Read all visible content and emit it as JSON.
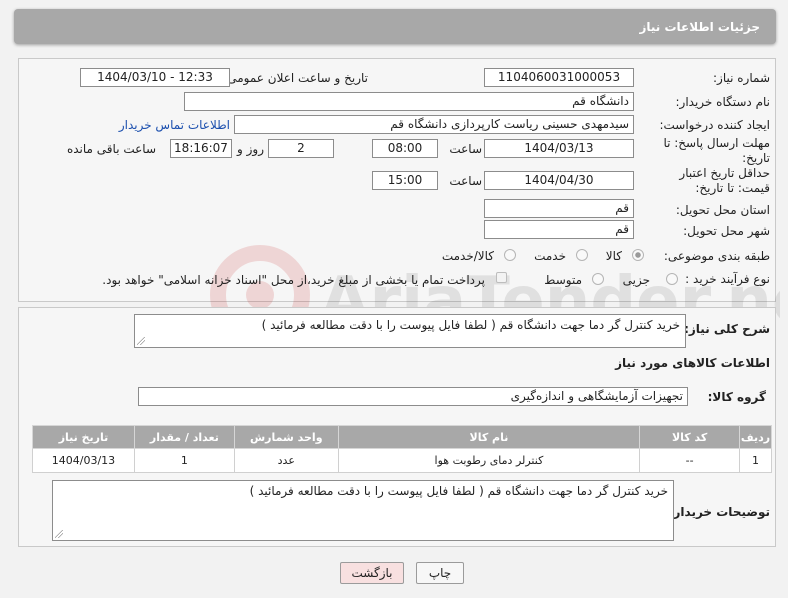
{
  "header": {
    "title": "جزئیات اطلاعات نیاز"
  },
  "form": {
    "need_number_label": "شماره نیاز:",
    "need_number": "1104060031000053",
    "announce_label": "تاریخ و ساعت اعلان عمومی:",
    "announce_value": "1404/03/10 - 12:33",
    "buyer_org_label": "نام دستگاه خریدار:",
    "buyer_org": "دانشگاه قم",
    "creator_label": "ایجاد کننده درخواست:",
    "creator": "سیدمهدی حسینی ریاست کارپردازی دانشگاه قم",
    "contact_link": "اطلاعات تماس خریدار",
    "deadline_label": "مهلت ارسال پاسخ: تا تاریخ:",
    "deadline_date": "1404/03/13",
    "time_word": "ساعت",
    "deadline_time": "08:00",
    "days_value": "2",
    "days_and_label": "روز و",
    "remaining_time": "18:16:07",
    "remaining_label": "ساعت باقی مانده",
    "min_validity_label": "حداقل تاریخ اعتبار قیمت: تا تاریخ:",
    "validity_date": "1404/04/30",
    "validity_time": "15:00",
    "province_label": "استان محل تحویل:",
    "province": "قم",
    "city_label": "شهر محل تحویل:",
    "city": "قم",
    "category_label": "طبقه بندی موضوعی:",
    "category_options": [
      "کالا",
      "خدمت",
      "کالا/خدمت"
    ],
    "process_label": "نوع فرآیند خرید :",
    "process_options": [
      "جزیی",
      "متوسط"
    ],
    "payment_note": "پرداخت تمام یا بخشی از مبلغ خرید،از محل \"اسناد خزانه اسلامی\" خواهد بود."
  },
  "description": {
    "label": "شرح کلی نیاز:",
    "text": "خرید کنترل گر دما جهت دانشگاه قم ( لطفا فایل پیوست را با دقت مطالعه فرمائید )"
  },
  "goods": {
    "section_title": "اطلاعات کالاهای مورد نیاز",
    "group_label": "گروه کالا:",
    "group_value": "تجهیزات آزمایشگاهی و اندازه‌گیری",
    "columns": [
      "ردیف",
      "کد کالا",
      "نام کالا",
      "واحد شمارش",
      "تعداد / مقدار",
      "تاریخ نیاز"
    ],
    "rows": [
      [
        "1",
        "--",
        "کنترلر دمای رطوبت هوا",
        "عدد",
        "1",
        "1404/03/13"
      ]
    ]
  },
  "buyer_notes": {
    "label": "توضیحات خریدار:",
    "text": "خرید کنترل گر دما جهت دانشگاه قم ( لطفا فایل پیوست را با دقت مطالعه فرمائید )"
  },
  "buttons": {
    "print": "چاپ",
    "back": "بازگشت"
  },
  "watermark": {
    "text": "AriaTender.net"
  },
  "colors": {
    "header_bg": "#a8a8a8",
    "link": "#1b4fae",
    "back_button_bg": "#f8e0e0"
  }
}
